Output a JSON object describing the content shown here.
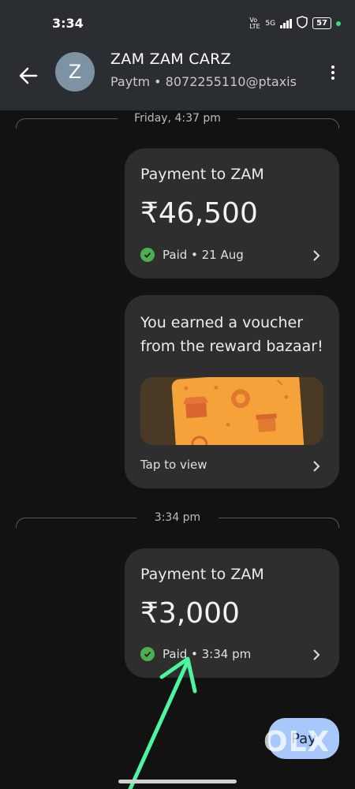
{
  "status_bar": {
    "time": "3:34",
    "network": "5G",
    "volte": "Vo LTE",
    "battery": "57"
  },
  "header": {
    "back_icon": "arrow-left-icon",
    "avatar_letter": "Z",
    "name": "ZAM ZAM CARZ",
    "subtitle": "Paytm • 8072255110@ptaxis",
    "menu_icon": "more-vert-icon"
  },
  "messages": [
    {
      "separator": "Friday, 4:37 pm"
    },
    {
      "title": "Payment to ZAM",
      "amount": "₹46,500",
      "status": "Paid • 21 Aug"
    },
    {
      "voucher_text": "You earned a voucher from the reward bazaar!",
      "cta": "Tap to view"
    },
    {
      "separator": "3:34 pm"
    },
    {
      "title": "Payment to ZAM",
      "amount": "₹3,000",
      "status": "Paid • 3:34 pm"
    }
  ],
  "pay_button": "Pay",
  "watermark": "OLX",
  "colors": {
    "background": "#121212",
    "header": "#2a2d31",
    "card": "#2e2e2e",
    "success": "#4caf50",
    "pay_button": "#a8c7fa",
    "voucher": "#f5a23a",
    "annotation_arrow": "#4ef5a0"
  }
}
